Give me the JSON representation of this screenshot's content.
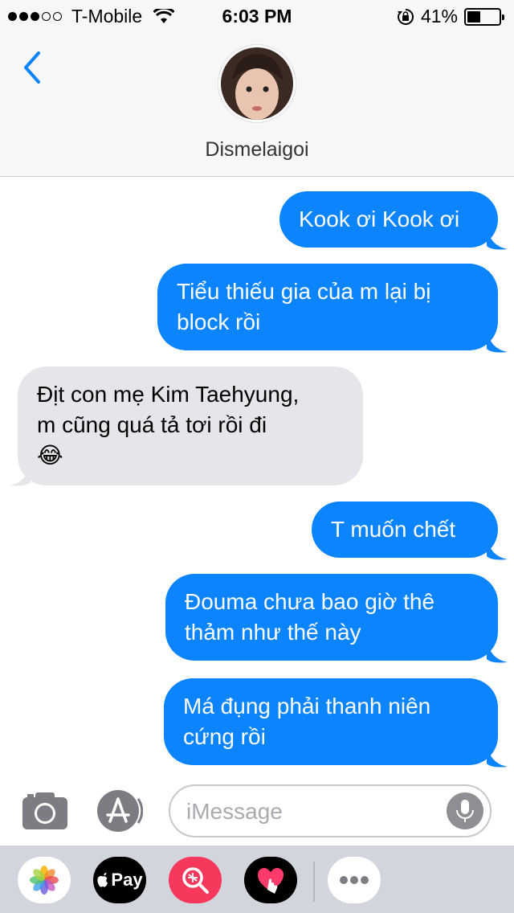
{
  "status_bar": {
    "carrier": "T-Mobile",
    "time": "6:03 PM",
    "battery": "41%",
    "battery_level": 0.41,
    "signal_bars": 3,
    "signal_total": 5
  },
  "header": {
    "back_label": "<",
    "contact_name": "Dismelaigoi"
  },
  "messages": [
    {
      "from": "me",
      "text": "Kook ơi Kook ơi"
    },
    {
      "from": "me",
      "lines": [
        "Tiểu thiếu gia của m lại bị",
        "block rồi"
      ]
    },
    {
      "from": "them",
      "lines": [
        "Địt con mẹ Kim Taehyung,",
        "m cũng quá tả tơi rồi đi",
        "😂"
      ]
    },
    {
      "from": "me",
      "text": "T muốn chết"
    },
    {
      "from": "me",
      "lines": [
        "Đouma chưa bao giờ thê",
        "thảm như thế này"
      ]
    },
    {
      "from": "me",
      "lines": [
        "Má đụng phải thanh niên",
        "cứng rồi"
      ]
    }
  ],
  "input": {
    "placeholder": "iMessage",
    "value": ""
  },
  "apps": [
    "photos-icon",
    "apple-pay-icon",
    "search-images-icon",
    "digital-touch-icon",
    "more-icon"
  ],
  "apple_pay_label": "Pay",
  "colors": {
    "sent_bubble": "#0b84fe",
    "received_bubble": "#e5e5ea",
    "accent": "#0b84fe"
  }
}
